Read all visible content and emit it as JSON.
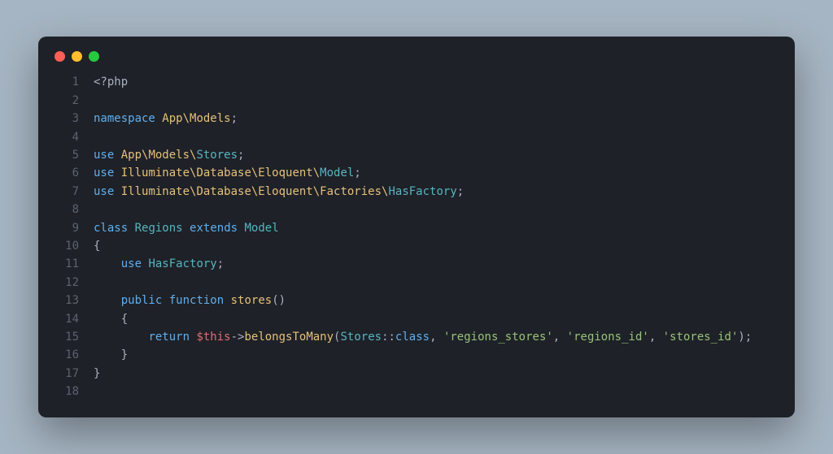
{
  "editor": {
    "lineNumbers": [
      "1",
      "2",
      "3",
      "4",
      "5",
      "6",
      "7",
      "8",
      "9",
      "10",
      "11",
      "12",
      "13",
      "14",
      "15",
      "16",
      "17",
      "18"
    ],
    "tokens": {
      "php_open": "<?php",
      "namespace_kw": "namespace",
      "app_models": "App\\Models",
      "semi": ";",
      "use_kw": "use",
      "app_models_bs": "App\\Models\\",
      "stores_cls": "Stores",
      "illum_db_eloq_bs": "Illuminate\\Database\\Eloquent\\",
      "model_cls": "Model",
      "illum_db_eloq_fact_bs": "Illuminate\\Database\\Eloquent\\Factories\\",
      "hasfactory_cls": "HasFactory",
      "class_kw": "class",
      "regions_cls": "Regions",
      "extends_kw": "extends",
      "lbrace": "{",
      "rbrace": "}",
      "hasfactory_use": "HasFactory",
      "public_kw": "public",
      "function_kw": "function",
      "stores_fn": "stores",
      "parens": "()",
      "return_kw": "return",
      "this_var": "$this",
      "arrow": "->",
      "btm_fn": "belongsToMany",
      "lparen": "(",
      "dcolon": "::",
      "class_prop": "class",
      "comma_sp": ", ",
      "str_regions_stores": "'regions_stores'",
      "str_regions_id": "'regions_id'",
      "str_stores_id": "'stores_id'",
      "rparen": ")"
    }
  }
}
